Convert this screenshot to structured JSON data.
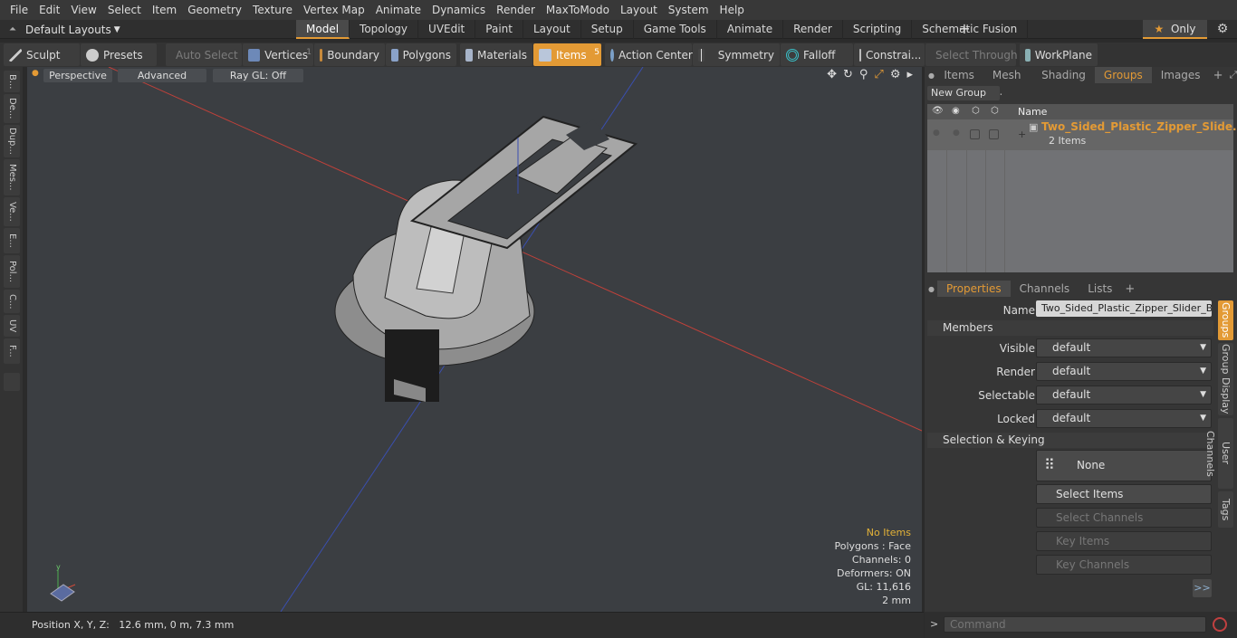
{
  "menu": [
    "File",
    "Edit",
    "View",
    "Select",
    "Item",
    "Geometry",
    "Texture",
    "Vertex Map",
    "Animate",
    "Dynamics",
    "Render",
    "MaxToModo",
    "Layout",
    "System",
    "Help"
  ],
  "layout_dropdown": "Default Layouts",
  "tabs": [
    "Model",
    "Topology",
    "UVEdit",
    "Paint",
    "Layout",
    "Setup",
    "Game Tools",
    "Animate",
    "Render",
    "Scripting",
    "Schematic Fusion"
  ],
  "only_label": "Only",
  "toolbar": {
    "sculpt": "Sculpt",
    "presets": "Presets",
    "auto_select": "Auto Select",
    "vertices": "Vertices",
    "vertices_count": "1",
    "boundary": "Boundary",
    "polygons": "Polygons",
    "materials": "Materials",
    "items": "Items",
    "items_count": "5",
    "action_center": "Action Center",
    "symmetry": "Symmetry",
    "falloff": "Falloff",
    "constraints": "Constrai...",
    "select_through": "Select Through",
    "workplane": "WorkPlane"
  },
  "left_tabs": [
    "B...",
    "De...",
    "Dup...",
    "Mes...",
    "Ve...",
    "E...",
    "Pol...",
    "C...",
    "UV",
    "F..."
  ],
  "viewport": {
    "perspective": "Perspective",
    "advanced": "Advanced",
    "raygl": "Ray GL: Off",
    "info": {
      "no_items": "No Items",
      "polygons": "Polygons : Face",
      "channels": "Channels: 0",
      "deformers": "Deformers: ON",
      "gl": "GL: 11,616",
      "scale": "2 mm"
    }
  },
  "status": {
    "position": "Position X, Y, Z:   12.6 mm, 0 m, 7.3 mm"
  },
  "right_top_tabs": [
    "Items",
    "Mesh ...",
    "Shading",
    "Groups",
    "Images"
  ],
  "new_group": "New Group",
  "group_list": {
    "name_col": "Name",
    "group_name": "Two_Sided_Plastic_Zipper_Slide...",
    "group_sub": "2 Items"
  },
  "right_bottom_tabs": [
    "Properties",
    "Channels",
    "Lists"
  ],
  "properties": {
    "name_label": "Name",
    "name_value": "Two_Sided_Plastic_Zipper_Slider_Black",
    "members": "Members",
    "visible_label": "Visible",
    "render_label": "Render",
    "selectable_label": "Selectable",
    "locked_label": "Locked",
    "default_value": "default",
    "selection_keying": "Selection & Keying",
    "none": "None",
    "select_items": "Select Items",
    "select_channels": "Select Channels",
    "key_items": "Key Items",
    "key_channels": "Key Channels",
    "more": ">>"
  },
  "side_tabs": [
    "Groups",
    "Group Display",
    "User Channels",
    "Tags"
  ],
  "command_placeholder": "Command",
  "colors": {
    "accent": "#e39a35",
    "viewport": "#3b3e42"
  }
}
